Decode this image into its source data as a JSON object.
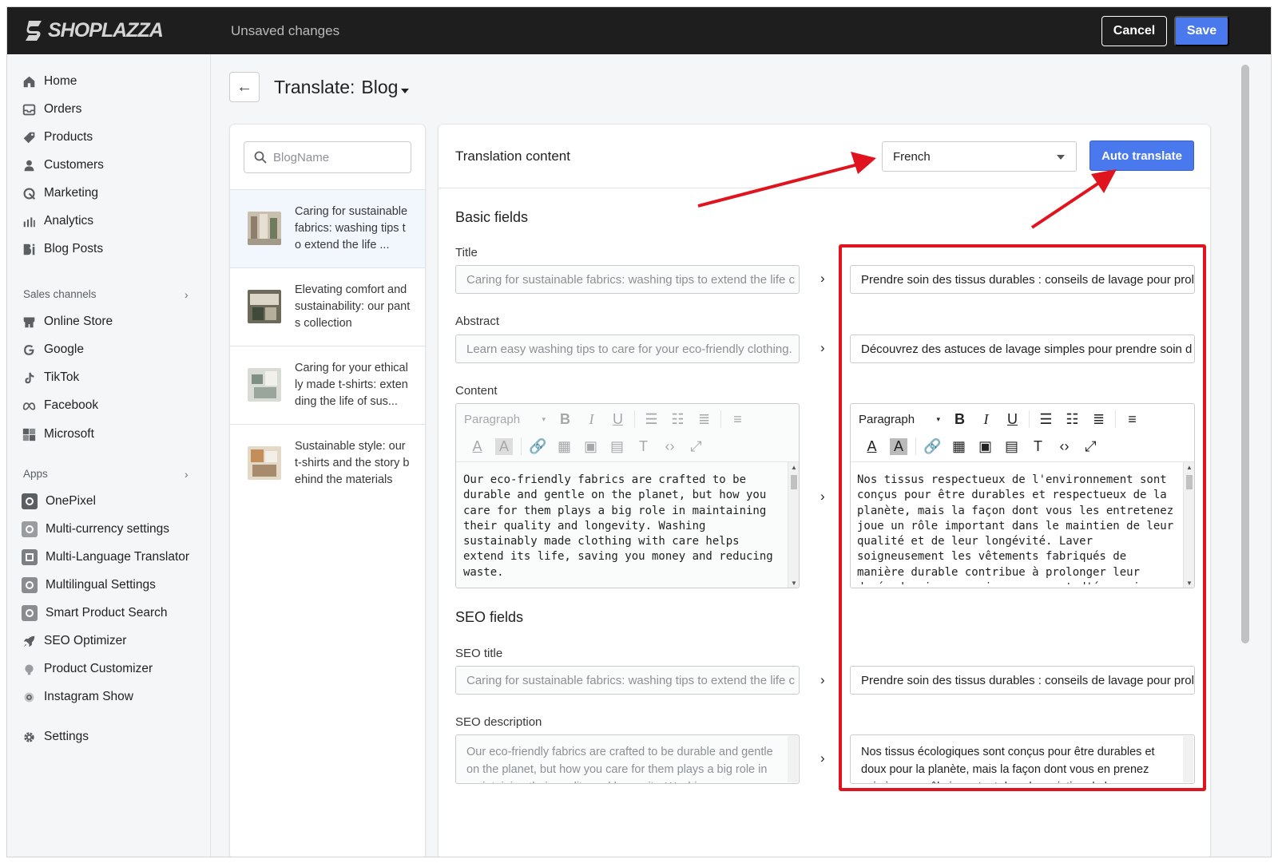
{
  "topbar": {
    "brand": "SHOPLAZZA",
    "status": "Unsaved changes",
    "cancel_label": "Cancel",
    "save_label": "Save"
  },
  "sidebar": {
    "main_items": [
      {
        "label": "Home",
        "icon": "home-icon"
      },
      {
        "label": "Orders",
        "icon": "orders-icon"
      },
      {
        "label": "Products",
        "icon": "tag-icon"
      },
      {
        "label": "Customers",
        "icon": "person-icon"
      },
      {
        "label": "Marketing",
        "icon": "marketing-icon"
      },
      {
        "label": "Analytics",
        "icon": "bar-chart-icon"
      },
      {
        "label": "Blog Posts",
        "icon": "blog-icon"
      }
    ],
    "sales_channels_label": "Sales channels",
    "channels": [
      {
        "label": "Online Store",
        "icon": "store-icon"
      },
      {
        "label": "Google",
        "icon": "google-icon"
      },
      {
        "label": "TikTok",
        "icon": "tiktok-icon"
      },
      {
        "label": "Facebook",
        "icon": "meta-icon"
      },
      {
        "label": "Microsoft",
        "icon": "microsoft-icon"
      }
    ],
    "apps_label": "Apps",
    "apps": [
      {
        "label": "OnePixel"
      },
      {
        "label": "Multi-currency settings"
      },
      {
        "label": "Multi-Language Translator"
      },
      {
        "label": "Multilingual Settings"
      },
      {
        "label": "Smart Product Search"
      },
      {
        "label": "SEO Optimizer"
      },
      {
        "label": "Product Customizer"
      },
      {
        "label": "Instagram Show"
      }
    ],
    "settings_label": "Settings"
  },
  "page": {
    "title": "Translate:",
    "resource": "Blog"
  },
  "list": {
    "search_placeholder": "BlogName",
    "posts": [
      {
        "title": "Caring for sustainable fabrics: washing tips to extend the life ..."
      },
      {
        "title": "Elevating comfort and sustainability: our pants collection"
      },
      {
        "title": "Caring for your ethically made t-shirts: extending the life of sus..."
      },
      {
        "title": "Sustainable style: our t-shirts and the story behind the materials"
      }
    ]
  },
  "editor": {
    "header": "Translation content",
    "language": "French",
    "auto_translate_label": "Auto translate",
    "basic_fields_heading": "Basic fields",
    "title_label": "Title",
    "title_source": "Caring for sustainable fabrics: washing tips to extend the life c",
    "title_translation": "Prendre soin des tissus durables : conseils de lavage pour prol",
    "abstract_label": "Abstract",
    "abstract_source": "Learn easy washing tips to care for your eco-friendly clothing.",
    "abstract_translation": "Découvrez des astuces de lavage simples pour prendre soin d",
    "content_label": "Content",
    "toolbar_paragraph": "Paragraph",
    "content_source": "Our eco-friendly fabrics are crafted to be durable and gentle on the planet, but how you care for them plays a big role in maintaining their quality and longevity. Washing sustainably made clothing with care helps extend its life, saving you money and reducing waste.",
    "content_translation": "Nos tissus respectueux de l'environnement sont conçus pour être durables et respectueux de la planète, mais la façon dont vous les entretenez joue un rôle important dans le maintien de leur qualité et de leur longévité. Laver soigneusement les vêtements fabriqués de manière durable contribue à prolonger leur durée de vie, ce qui vous permet d'économiser de l'argent et de réduire les déchets.",
    "seo_fields_heading": "SEO fields",
    "seo_title_label": "SEO title",
    "seo_title_source": "Caring for sustainable fabrics: washing tips to extend the life c",
    "seo_title_translation": "Prendre soin des tissus durables : conseils de lavage pour prol",
    "seo_description_label": "SEO description",
    "seo_description_source": "Our eco-friendly fabrics are crafted to be durable and gentle on the planet, but how you care for them plays a big role in maintaining their quality and longevity. Washing",
    "seo_description_translation": "Nos tissus écologiques sont conçus pour être durables et doux pour la planète, mais la façon dont vous en prenez soin joue un rôle important dans le maintien de leur"
  },
  "colors": {
    "topbar": "#1e1e1e",
    "primary": "#4a79ee",
    "annotation": "#e0141e"
  }
}
